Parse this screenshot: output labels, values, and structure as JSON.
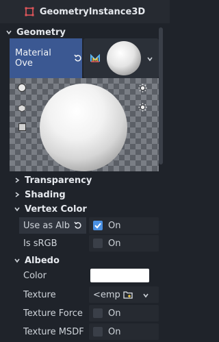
{
  "title": "GeometryInstance3D",
  "sections": {
    "geometry": "Geometry",
    "transparency": "Transparency",
    "shading": "Shading",
    "vertex_color": "Vertex Color",
    "albedo": "Albedo"
  },
  "material_override": {
    "label": "Material Ove"
  },
  "vertex_color": {
    "use_as_albedo": {
      "label": "Use as Alb",
      "value": "On",
      "checked": true
    },
    "is_srgb": {
      "label": "Is sRGB",
      "value": "On",
      "checked": false
    }
  },
  "albedo": {
    "color_label": "Color",
    "color_value": "#ffffff",
    "texture_label": "Texture",
    "texture_value": "<emp",
    "texture_force_label": "Texture Force",
    "texture_force_value": "On",
    "texture_msdf_label": "Texture MSDF",
    "texture_msdf_value": "On"
  },
  "colors": {
    "accent": "#4a90e2",
    "node_icon": "#e0565b",
    "highlight": "#3b5892"
  }
}
